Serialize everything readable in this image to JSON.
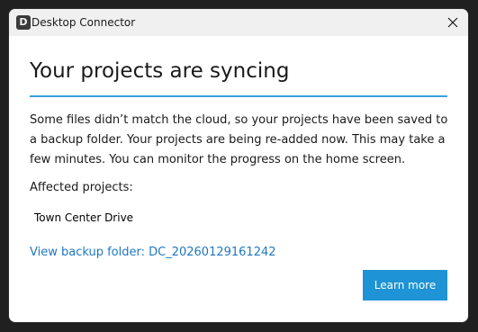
{
  "window": {
    "title": "Desktop Connector",
    "app_icon_glyph": "D",
    "close_icon": "close-icon"
  },
  "dialog": {
    "heading": "Your projects are syncing",
    "message": "Some files didn’t match the cloud, so your projects have been saved to a backup folder. Your projects are being re-added now. This may take a few minutes. You can monitor the progress on the home screen.",
    "affected_label": "Affected projects:",
    "projects": [
      "Town Center Drive"
    ],
    "backup_link": "View backup folder: DC_20260129161242",
    "learn_more_label": "Learn more"
  },
  "colors": {
    "accent_rule": "#3aa0d8",
    "link": "#1f78c0",
    "primary_button": "#1e93d5",
    "titlebar": "#f0f0f0"
  }
}
